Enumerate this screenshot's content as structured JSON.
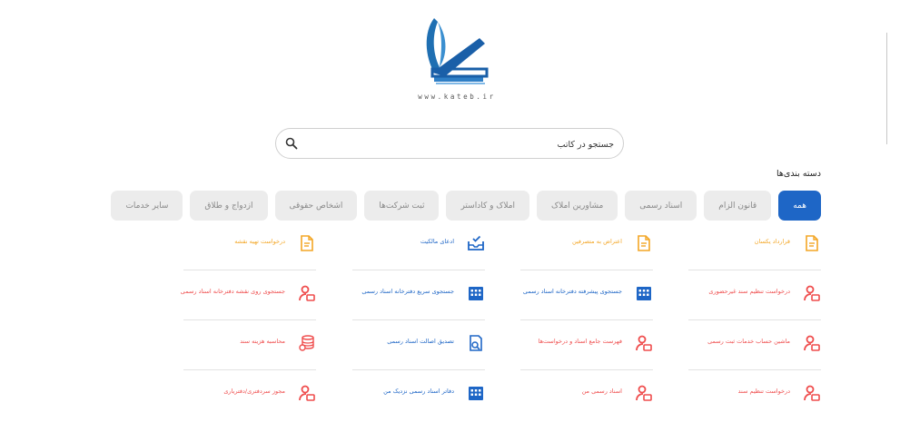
{
  "logo": {
    "url_text": "www.kateb.ir"
  },
  "search": {
    "placeholder": "جستجو در کاتب"
  },
  "categories": {
    "title": "دسته بندی‌ها",
    "tabs": [
      "همه",
      "قانون الزام",
      "اسناد رسمی",
      "مشاورین املاک",
      "املاک و کاداستر",
      "ثبت شرکت‌ها",
      "اشخاص حقوقی",
      "ازدواج و طلاق",
      "سایر خدمات"
    ]
  },
  "services": [
    {
      "label": "قرارداد یکسان",
      "icon": "document-icon",
      "color": "#f3a625"
    },
    {
      "label": "اعتراض به متصرفین",
      "icon": "document-icon",
      "color": "#f3a625"
    },
    {
      "label": "ادعای مالکیت",
      "icon": "inbox-check-icon",
      "color": "#1e66c6"
    },
    {
      "label": "درخواست تهیه نقشه",
      "icon": "document-icon",
      "color": "#f3a625"
    },
    {
      "label": "درخواست تنظیم سند غیرحضوری",
      "icon": "user-icon",
      "color": "#ef4d4d"
    },
    {
      "label": "جستجوی پیشرفته دفترخانه اسناد رسمی",
      "icon": "building-icon",
      "color": "#1e66c6"
    },
    {
      "label": "جستجوی سریع دفترخانه اسناد رسمی",
      "icon": "building-icon",
      "color": "#1e66c6"
    },
    {
      "label": "جستجوی روی نقشه دفترخانه اسناد رسمی",
      "icon": "user-icon",
      "color": "#ef4d4d"
    },
    {
      "label": "ماشین حساب خدمات ثبت رسمی",
      "icon": "user-icon",
      "color": "#ef4d4d"
    },
    {
      "label": "فهرست جامع اسناد و درخواست‌ها",
      "icon": "user-icon",
      "color": "#ef4d4d"
    },
    {
      "label": "تصدیق اصالت اسناد رسمی",
      "icon": "verify-icon",
      "color": "#1e66c6"
    },
    {
      "label": "محاسبه هزینه سند",
      "icon": "coins-icon",
      "color": "#ef4d4d"
    },
    {
      "label": "درخواست تنظیم سند",
      "icon": "user-icon",
      "color": "#ef4d4d"
    },
    {
      "label": "اسناد رسمی من",
      "icon": "user-icon",
      "color": "#ef4d4d"
    },
    {
      "label": "دفاتر اسناد رسمی نزدیک من",
      "icon": "building-icon",
      "color": "#1e66c6"
    },
    {
      "label": "مجوز سردفتری/دفتریاری",
      "icon": "user-icon",
      "color": "#ef4d4d"
    }
  ]
}
